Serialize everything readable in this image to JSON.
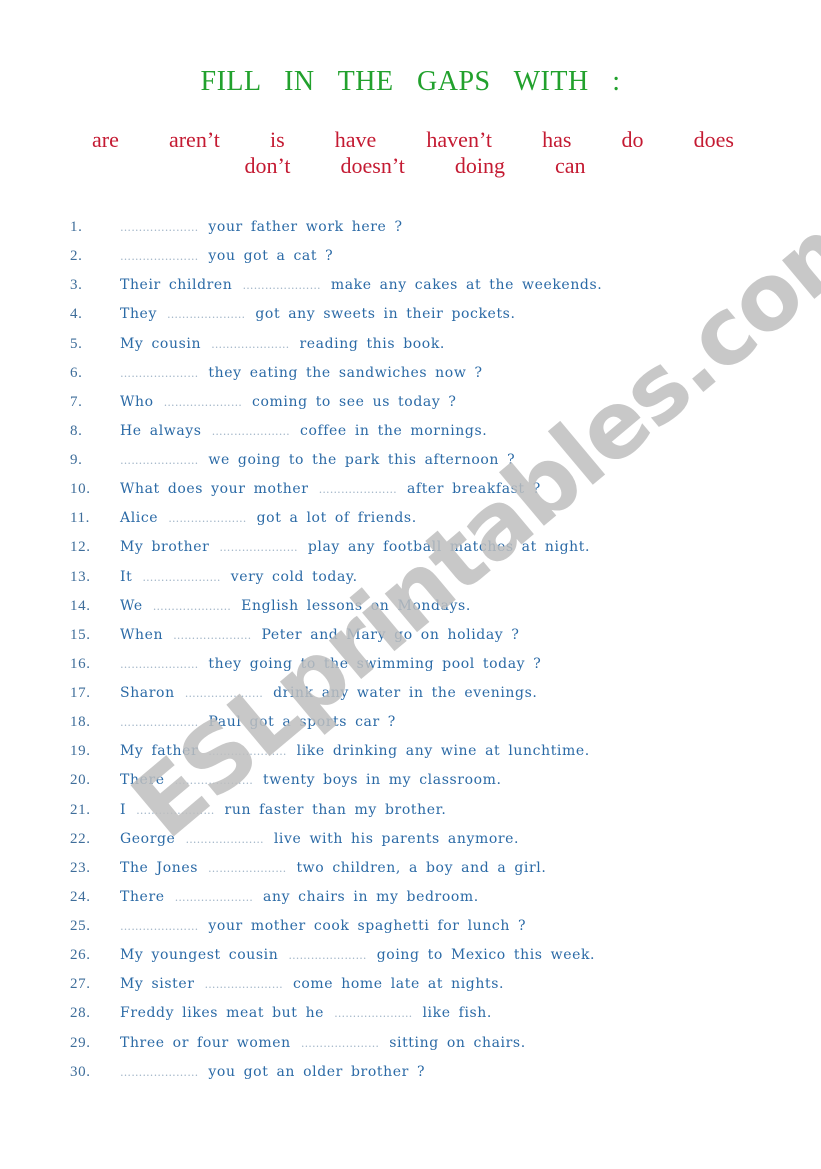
{
  "title": "FILL  IN  THE  GAPS  WITH :",
  "word_bank": {
    "row1": [
      "are",
      "aren’t",
      "is",
      "have",
      "haven’t",
      "has",
      "do",
      "does"
    ],
    "row2": [
      "don’t",
      "doesn’t",
      "doing",
      "can"
    ]
  },
  "blank": "…………………",
  "items": [
    {
      "num": "1.",
      "before": "",
      "after": "your father work here ?"
    },
    {
      "num": "2.",
      "before": "",
      "after": "you got a cat ?"
    },
    {
      "num": "3.",
      "before": "Their children",
      "after": "make any cakes at the weekends."
    },
    {
      "num": "4.",
      "before": "They",
      "after": "got any sweets in their pockets."
    },
    {
      "num": "5.",
      "before": "My cousin",
      "after": "reading this book."
    },
    {
      "num": "6.",
      "before": "",
      "after": "they eating the sandwiches now ?"
    },
    {
      "num": "7.",
      "before": "Who",
      "after": "coming to see us today ?"
    },
    {
      "num": "8.",
      "before": "He always",
      "after": "coffee in the mornings."
    },
    {
      "num": "9.",
      "before": "",
      "after": "we going to the park this afternoon ?"
    },
    {
      "num": "10.",
      "before": "What does your mother",
      "after": "after breakfast ?"
    },
    {
      "num": "11.",
      "before": "Alice",
      "after": "got a lot of friends."
    },
    {
      "num": "12.",
      "before": "My brother",
      "after": "play any football matches at night."
    },
    {
      "num": "13.",
      "before": "It",
      "after": "very cold today."
    },
    {
      "num": "14.",
      "before": "We",
      "after": "English lessons on Mondays."
    },
    {
      "num": "15.",
      "before": "When",
      "after": "Peter and Mary go on holiday ?"
    },
    {
      "num": "16.",
      "before": "",
      "after": "they going to the swimming pool today ?"
    },
    {
      "num": "17.",
      "before": "Sharon",
      "after": "drink any water in the evenings."
    },
    {
      "num": "18.",
      "before": "",
      "after": "Paul got a sports car ?"
    },
    {
      "num": "19.",
      "before": "My father",
      "after": "like drinking any wine at lunchtime."
    },
    {
      "num": "20.",
      "before": "There",
      "after": "twenty boys in my classroom."
    },
    {
      "num": "21.",
      "before": "I",
      "after": "run faster than my brother."
    },
    {
      "num": "22.",
      "before": "George",
      "after": "live with his parents anymore."
    },
    {
      "num": "23.",
      "before": "The Jones",
      "after": "two children, a boy and a girl."
    },
    {
      "num": "24.",
      "before": "There",
      "after": "any chairs in my bedroom."
    },
    {
      "num": "25.",
      "before": "",
      "after": "your mother cook spaghetti for lunch ?"
    },
    {
      "num": "26.",
      "before": "My youngest cousin",
      "after": "going to Mexico this week."
    },
    {
      "num": "27.",
      "before": "My sister",
      "after": "come home late at nights."
    },
    {
      "num": "28.",
      "before": "Freddy likes meat but he",
      "after": "like fish."
    },
    {
      "num": "29.",
      "before": "Three or four women",
      "after": "sitting on chairs."
    },
    {
      "num": "30.",
      "before": "",
      "after": "you got an older brother ?"
    }
  ],
  "watermark": "ESLprintables.com",
  "colors": {
    "title": "#22a12d",
    "word_bank": "#c41a32",
    "sentence_text": "#2b6aa6",
    "blank_dots": "#9fb3c6",
    "watermark": "#bebebe"
  }
}
